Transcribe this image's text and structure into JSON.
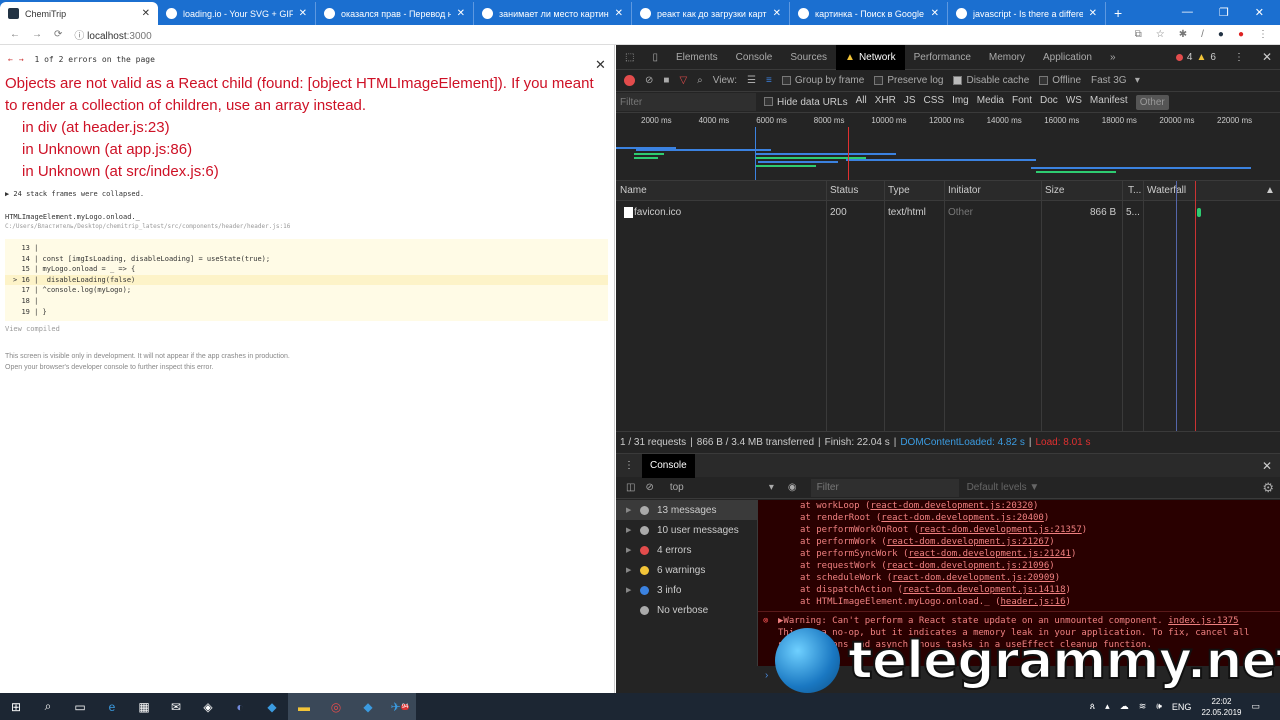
{
  "browser": {
    "tabs": [
      {
        "title": "ChemiTrip",
        "active": true
      },
      {
        "title": "loading.io - Your SVG + GIF + PNG"
      },
      {
        "title": "оказался прав - Перевод на англ"
      },
      {
        "title": "занимает ли место картинка на"
      },
      {
        "title": "реакт как до загрузки картинки"
      },
      {
        "title": "картинка - Поиск в Google"
      },
      {
        "title": "javascript - Is there a difference"
      }
    ],
    "new_tab": "+",
    "url_host": "localhost",
    "url_port": ":3000"
  },
  "overlay": {
    "nav": "1 of 2 errors on the page",
    "title": "Objects are not valid as a React child (found: [object HTMLImageElement]). If you meant to render a collection of children, use an array instead.",
    "stack": [
      "in div (at header.js:23)",
      "in Unknown (at app.js:86)",
      "in Unknown (at src/index.js:6)"
    ],
    "collapsed": "▶ 24 stack frames were collapsed.",
    "function": "HTMLImageElement.myLogo.onload._",
    "file": "C:/Users/Властитель/Desktop/chemitrip_latest/src/components/header/header.js:16",
    "code": [
      {
        "n": "13",
        "text": ""
      },
      {
        "n": "14",
        "text": "const [imgIsLoading, disableLoading] = useState(true);"
      },
      {
        "n": "15",
        "text": "myLogo.onload = _ => {"
      },
      {
        "n": "16",
        "text": " disableLoading(false)",
        "highlight": true
      },
      {
        "n": "17",
        "text": "^console.log(myLogo);"
      },
      {
        "n": "18",
        "text": ""
      },
      {
        "n": "19",
        "text": "}"
      }
    ],
    "view_compiled": "View compiled",
    "note1": "This screen is visible only in development. It will not appear if the app crashes in production.",
    "note2": "Open your browser's developer console to further inspect this error."
  },
  "devtools": {
    "tabs": [
      "Elements",
      "Console",
      "Sources",
      "Network",
      "Performance",
      "Memory",
      "Application",
      "»"
    ],
    "active_tab": "Network",
    "errors": "4",
    "warnings": "6",
    "toolbar": {
      "view": "View:",
      "group_by_frame": "Group by frame",
      "preserve_log": "Preserve log",
      "disable_cache": "Disable cache",
      "disable_cache_checked": true,
      "offline": "Offline",
      "throttle": "Fast 3G"
    },
    "filter_placeholder": "Filter",
    "hide_data_urls": "Hide data URLs",
    "types": [
      "All",
      "XHR",
      "JS",
      "CSS",
      "Img",
      "Media",
      "Font",
      "Doc",
      "WS",
      "Manifest",
      "Other"
    ],
    "active_type": "Other",
    "ticks": [
      "2000 ms",
      "4000 ms",
      "6000 ms",
      "8000 ms",
      "10000 ms",
      "12000 ms",
      "14000 ms",
      "16000 ms",
      "18000 ms",
      "20000 ms",
      "22000 ms"
    ],
    "columns": [
      "Name",
      "Status",
      "Type",
      "Initiator",
      "Size",
      "T...",
      "Waterfall"
    ],
    "rows": [
      {
        "name": "favicon.ico",
        "status": "200",
        "type": "text/html",
        "initiator": "Other",
        "size": "866 B",
        "time": "5..."
      }
    ],
    "summary": {
      "requests": "1 / 31 requests",
      "transferred": "866 B / 3.4 MB transferred",
      "finish": "Finish: 22.04 s",
      "dcl": "DOMContentLoaded: 4.82 s",
      "load": "Load: 8.01 s"
    },
    "drawer_tab": "Console",
    "context": "top",
    "console_filter": "Filter",
    "levels": "Default levels ▼",
    "sidebar": [
      {
        "label": "13 messages",
        "icon": "list-icon",
        "color": "#aaaaaa"
      },
      {
        "label": "10 user messages",
        "icon": "user-icon",
        "color": "#aaaaaa"
      },
      {
        "label": "4 errors",
        "icon": "error-icon",
        "color": "#e34c4c"
      },
      {
        "label": "6 warnings",
        "icon": "warning-icon",
        "color": "#f2c438"
      },
      {
        "label": "3 info",
        "icon": "info-icon",
        "color": "#3b82e0"
      },
      {
        "label": "No verbose",
        "icon": "verbose-icon",
        "color": "#aaaaaa"
      }
    ],
    "stack": [
      {
        "fn": "at workLoop",
        "src": "react-dom.development.js:20320"
      },
      {
        "fn": "at renderRoot",
        "src": "react-dom.development.js:20400"
      },
      {
        "fn": "at performWorkOnRoot",
        "src": "react-dom.development.js:21357"
      },
      {
        "fn": "at performWork",
        "src": "react-dom.development.js:21267"
      },
      {
        "fn": "at performSyncWork",
        "src": "react-dom.development.js:21241"
      },
      {
        "fn": "at requestWork",
        "src": "react-dom.development.js:21096"
      },
      {
        "fn": "at scheduleWork",
        "src": "react-dom.development.js:20909"
      },
      {
        "fn": "at dispatchAction",
        "src": "react-dom.development.js:14118"
      },
      {
        "fn": "at HTMLImageElement.myLogo.onload._",
        "src": "header.js:16"
      }
    ],
    "warning": "▶Warning: Can't perform a React state update on an unmounted component.",
    "warning_src": "index.js:1375",
    "warning_body": "This is a no-op, but it indicates a memory leak in your application. To fix, cancel all subscriptions and asynchronous tasks in a useEffect cleanup function.",
    "prompt": "›"
  },
  "watermark": "telegrammy.net",
  "taskbar": {
    "lang": "ENG",
    "time": "22:02",
    "date": "22.05.2019",
    "badge": "94"
  },
  "colors": {
    "tabbar": "#1b6fd0",
    "error": "#ce1126",
    "devtools_bg": "#242424",
    "dcl": "#3b9be0",
    "load": "#e03030"
  }
}
